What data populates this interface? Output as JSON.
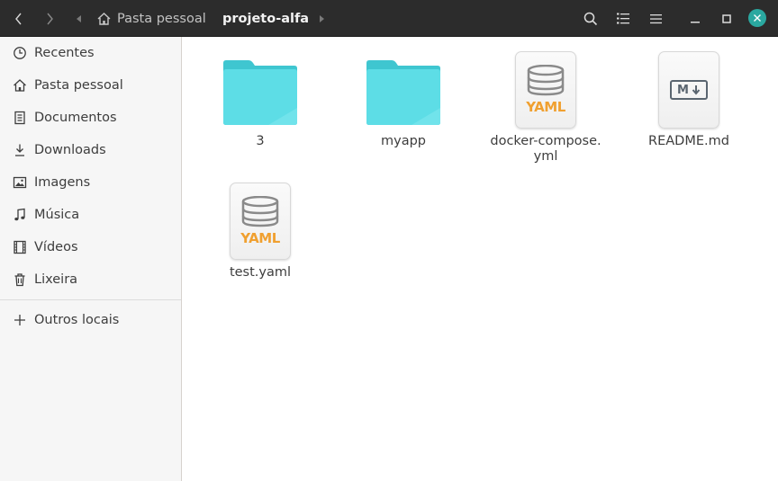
{
  "header": {
    "home_label": "Pasta pessoal",
    "current_folder": "projeto-alfa"
  },
  "sidebar": {
    "items": [
      {
        "label": "Recentes",
        "icon": "clock-icon"
      },
      {
        "label": "Pasta pessoal",
        "icon": "home-icon"
      },
      {
        "label": "Documentos",
        "icon": "document-icon"
      },
      {
        "label": "Downloads",
        "icon": "download-icon"
      },
      {
        "label": "Imagens",
        "icon": "image-icon"
      },
      {
        "label": "Música",
        "icon": "music-icon"
      },
      {
        "label": "Vídeos",
        "icon": "video-icon"
      },
      {
        "label": "Lixeira",
        "icon": "trash-icon"
      }
    ],
    "other_locations": {
      "label": "Outros locais",
      "icon": "plus-icon"
    }
  },
  "files": [
    {
      "name": "3",
      "type": "folder"
    },
    {
      "name": "myapp",
      "type": "folder"
    },
    {
      "name": "docker-compose.\nyml",
      "type": "yaml"
    },
    {
      "name": "README.md",
      "type": "markdown"
    },
    {
      "name": "test.yaml",
      "type": "yaml"
    }
  ],
  "yaml_badge": "YAML",
  "markdown_badge": "M",
  "colors": {
    "headerbar": "#2c2c2c",
    "folder": "#4dd4de",
    "yaml_badge": "#f0a030",
    "close_button": "#2aa8a0"
  }
}
